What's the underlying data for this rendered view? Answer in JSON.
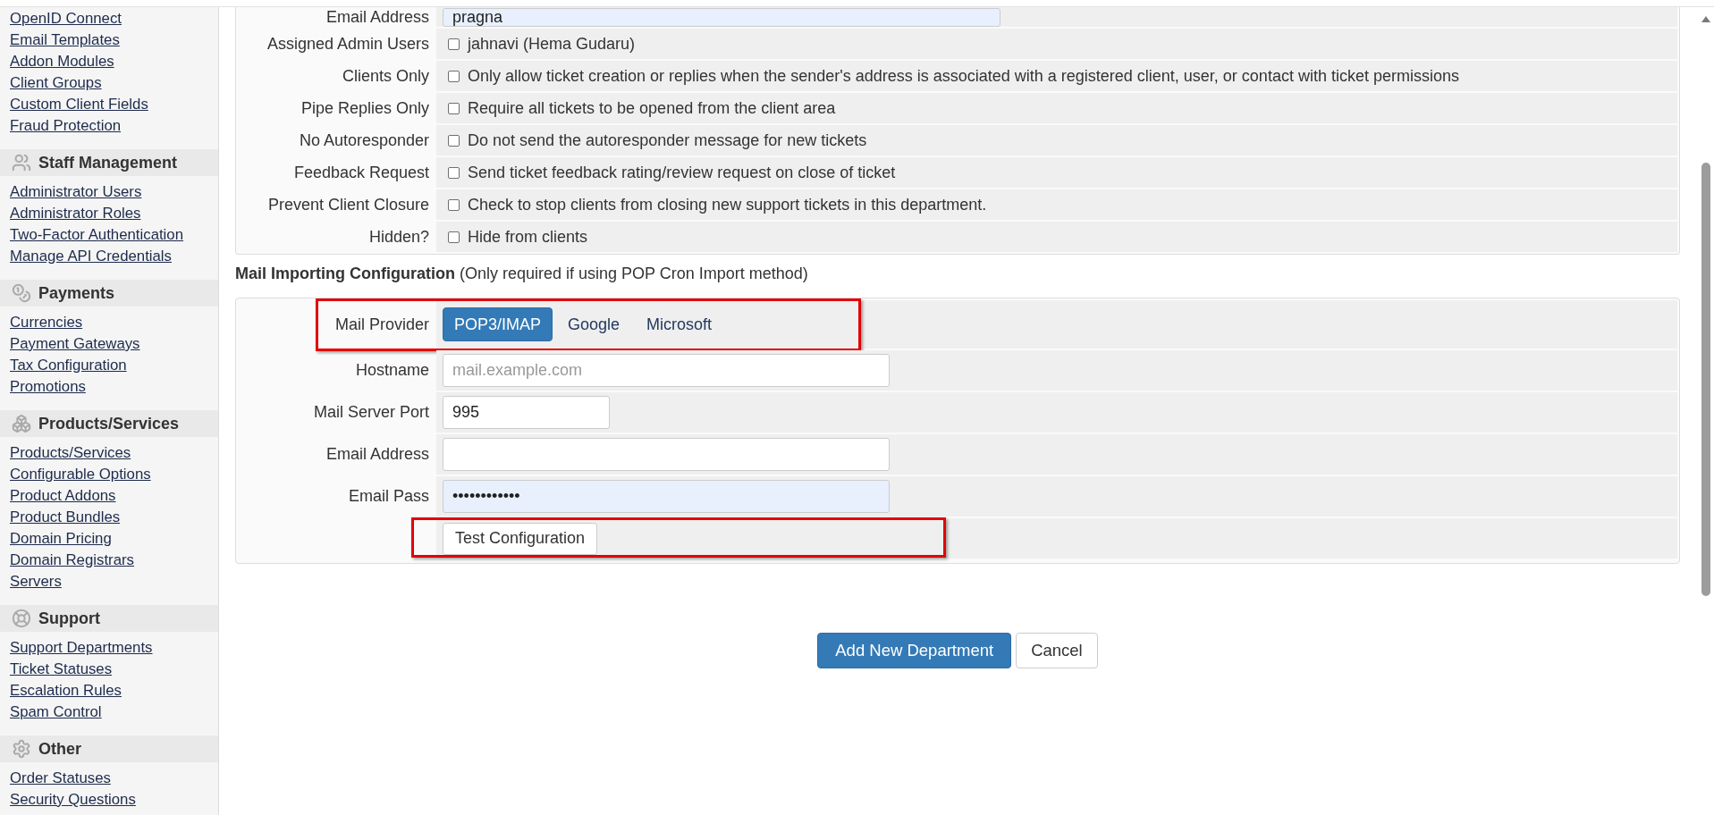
{
  "sidebar": {
    "sections": [
      {
        "links": [
          "OpenID Connect",
          "Email Templates",
          "Addon Modules",
          "Client Groups",
          "Custom Client Fields",
          "Fraud Protection"
        ]
      },
      {
        "title": "Staff Management",
        "links": [
          "Administrator Users",
          "Administrator Roles",
          "Two-Factor Authentication",
          "Manage API Credentials"
        ]
      },
      {
        "title": "Payments",
        "links": [
          "Currencies",
          "Payment Gateways",
          "Tax Configuration",
          "Promotions"
        ]
      },
      {
        "title": "Products/Services",
        "links": [
          "Products/Services",
          "Configurable Options",
          "Product Addons",
          "Product Bundles",
          "Domain Pricing",
          "Domain Registrars",
          "Servers"
        ]
      },
      {
        "title": "Support",
        "links": [
          "Support Departments",
          "Ticket Statuses",
          "Escalation Rules",
          "Spam Control"
        ]
      },
      {
        "title": "Other",
        "links": [
          "Order Statuses",
          "Security Questions"
        ]
      }
    ]
  },
  "department_form": {
    "rows": [
      {
        "kind": "text",
        "label": "Email Address",
        "value": "pragna",
        "autofilled": true
      },
      {
        "kind": "checkbox",
        "label": "Assigned Admin Users",
        "option": "jahnavi (Hema Gudaru)",
        "checked": false
      },
      {
        "kind": "checkbox",
        "label": "Clients Only",
        "option": "Only allow ticket creation or replies when the sender's address is associated with a registered client, user, or contact with ticket permissions",
        "checked": false
      },
      {
        "kind": "checkbox",
        "label": "Pipe Replies Only",
        "option": "Require all tickets to be opened from the client area",
        "checked": false
      },
      {
        "kind": "checkbox",
        "label": "No Autoresponder",
        "option": "Do not send the autoresponder message for new tickets",
        "checked": false
      },
      {
        "kind": "checkbox",
        "label": "Feedback Request",
        "option": "Send ticket feedback rating/review request on close of ticket",
        "checked": false
      },
      {
        "kind": "checkbox",
        "label": "Prevent Client Closure",
        "option": "Check to stop clients from closing new support tickets in this department.",
        "checked": false
      },
      {
        "kind": "checkbox",
        "label": "Hidden?",
        "option": "Hide from clients",
        "checked": false
      }
    ]
  },
  "mail_importing": {
    "title": "**Mail Importing Configuration** (Only required if using POP Cron Import method)",
    "rows": [
      {
        "kind": "provider",
        "label": "Mail Provider",
        "highlighted": true,
        "options": [
          {
            "label": "POP3/IMAP",
            "selected": true
          },
          {
            "label": "Google",
            "selected": false
          },
          {
            "label": "Microsoft",
            "selected": false
          }
        ]
      },
      {
        "kind": "text",
        "label": "Hostname",
        "placeholder": "mail.example.com",
        "autofilled": false,
        "highlighted": false
      },
      {
        "kind": "number",
        "label": "Mail Server Port",
        "value": "995",
        "autofilled": false,
        "highlighted": false
      },
      {
        "kind": "text",
        "label": "Email Address",
        "autofilled": false,
        "highlighted": false
      },
      {
        "kind": "password",
        "label": "Email Pass",
        "value": "••••••••••••",
        "autofilled": true,
        "highlighted": false
      },
      {
        "kind": "button",
        "button_label": "Test Configuration",
        "highlighted": true
      }
    ]
  },
  "actions": [
    {
      "kind": "primary",
      "label": "Add New Department"
    },
    {
      "kind": "default",
      "label": "Cancel"
    }
  ]
}
